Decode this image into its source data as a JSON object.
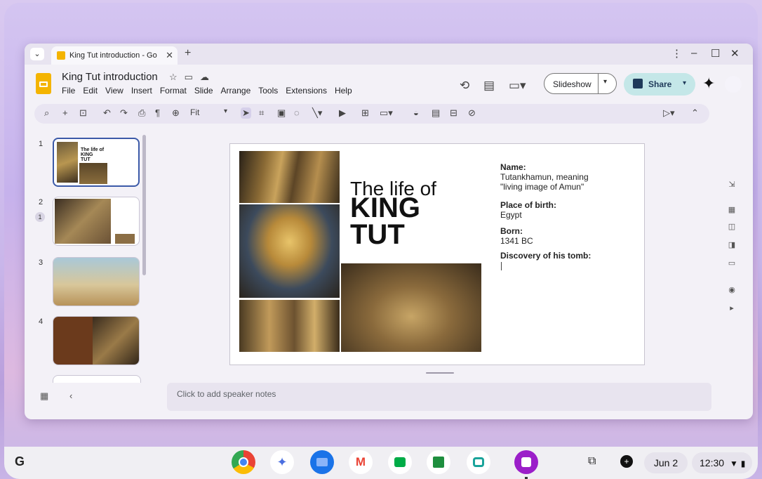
{
  "browser": {
    "tab_title": "King Tut introduction - Go",
    "tab_close": "✕",
    "new_tab": "+",
    "tab_menu": "⌄",
    "window_controls": [
      "⋮",
      "–",
      "☐",
      "✕"
    ]
  },
  "app": {
    "doc_title": "King Tut introduction",
    "title_icons": [
      "star-icon",
      "move-icon",
      "cloud-icon"
    ],
    "menu": [
      "File",
      "Edit",
      "View",
      "Insert",
      "Format",
      "Slide",
      "Arrange",
      "Tools",
      "Extensions",
      "Help"
    ],
    "slideshow_label": "Slideshow",
    "share_label": "Share",
    "zoom_label": "Fit"
  },
  "toolbar_icons": [
    "search-icon",
    "add-icon",
    "new-slide-icon",
    "undo-icon",
    "redo-icon",
    "print-icon",
    "paint-format-icon",
    "zoom-icon",
    "select-icon",
    "text-box-icon",
    "image-icon",
    "shape-icon",
    "line-icon",
    "video-icon",
    "comment-icon",
    "layout-icon",
    "fill-icon",
    "border-icon",
    "transition-icon",
    "pen-icon"
  ],
  "slides": [
    {
      "number": "1"
    },
    {
      "number": "2",
      "comment_count": "1"
    },
    {
      "number": "3"
    },
    {
      "number": "4"
    }
  ],
  "slide": {
    "title_line1": "The life of",
    "title_line2": "KING",
    "title_line3": "TUT",
    "fields": [
      {
        "label": "Name:",
        "value_line1": "Tutankhamun, meaning",
        "value_line2": "\"living image of Amun\""
      },
      {
        "label": "Place of birth:",
        "value_line1": "Egypt"
      },
      {
        "label": "Born:",
        "value_line1": "1341 BC"
      },
      {
        "label": "Discovery of his tomb:"
      }
    ]
  },
  "notes_placeholder": "Click to add speaker notes",
  "shelf": {
    "launcher": "G",
    "date": "Jun 2",
    "time": "12:30"
  },
  "colors": {
    "accent": "#3c5aa8",
    "share_bg": "#c4e7e8",
    "slides_yellow": "#f4b400"
  }
}
